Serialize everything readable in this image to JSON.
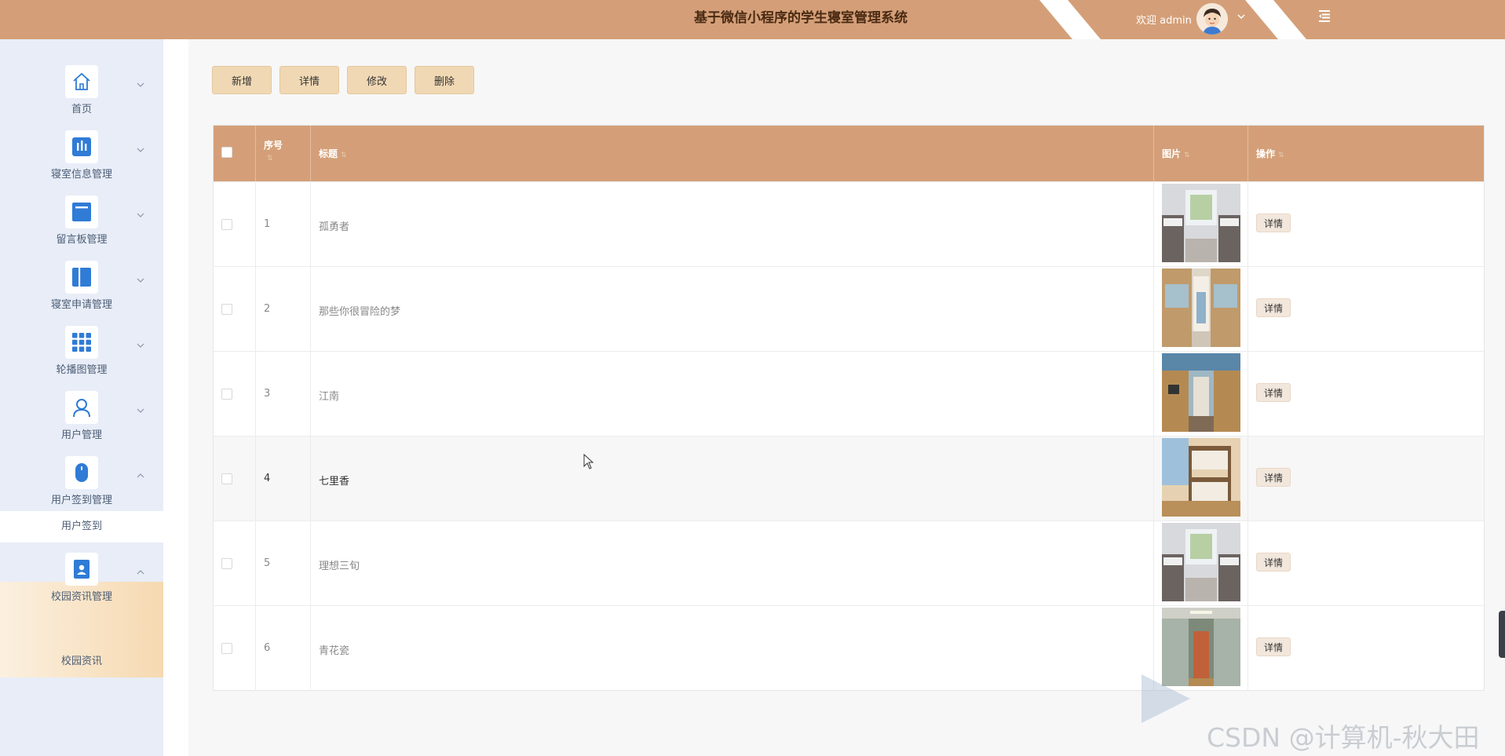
{
  "header": {
    "title": "基于微信小程序的学生寝室管理系统",
    "welcome": "欢迎 admin"
  },
  "sidebar": {
    "items": [
      {
        "label": "首页",
        "icon": "home-icon",
        "expanded": false
      },
      {
        "label": "寝室信息管理",
        "icon": "chart-icon",
        "expanded": false
      },
      {
        "label": "留言板管理",
        "icon": "board-icon",
        "expanded": false
      },
      {
        "label": "寝室申请管理",
        "icon": "panel-icon",
        "expanded": false
      },
      {
        "label": "轮播图管理",
        "icon": "grid-icon",
        "expanded": false
      },
      {
        "label": "用户管理",
        "icon": "user-icon",
        "expanded": false
      },
      {
        "label": "用户签到管理",
        "icon": "mouse-icon",
        "expanded": true
      },
      {
        "label": "校园资讯管理",
        "icon": "contact-icon",
        "expanded": true
      }
    ],
    "sub_checkin": "用户签到",
    "sub_news": "校园资讯"
  },
  "toolbar": {
    "add": "新增",
    "detail": "详情",
    "edit": "修改",
    "delete": "删除"
  },
  "table": {
    "columns": [
      "序号",
      "标题",
      "图片",
      "操作"
    ],
    "rows": [
      {
        "index": "1",
        "title": "孤勇者",
        "action": "详情"
      },
      {
        "index": "2",
        "title": "那些你很冒险的梦",
        "action": "详情"
      },
      {
        "index": "3",
        "title": "江南",
        "action": "详情"
      },
      {
        "index": "4",
        "title": "七里香",
        "action": "详情"
      },
      {
        "index": "5",
        "title": "理想三旬",
        "action": "详情"
      },
      {
        "index": "6",
        "title": "青花瓷",
        "action": "详情"
      }
    ]
  },
  "watermark": "CSDN @计算机-秋大田",
  "colors": {
    "header": "#d49f78",
    "sidebar": "#e8edf8",
    "button": "#f0d8b4",
    "accent": "#2f7bd6"
  }
}
